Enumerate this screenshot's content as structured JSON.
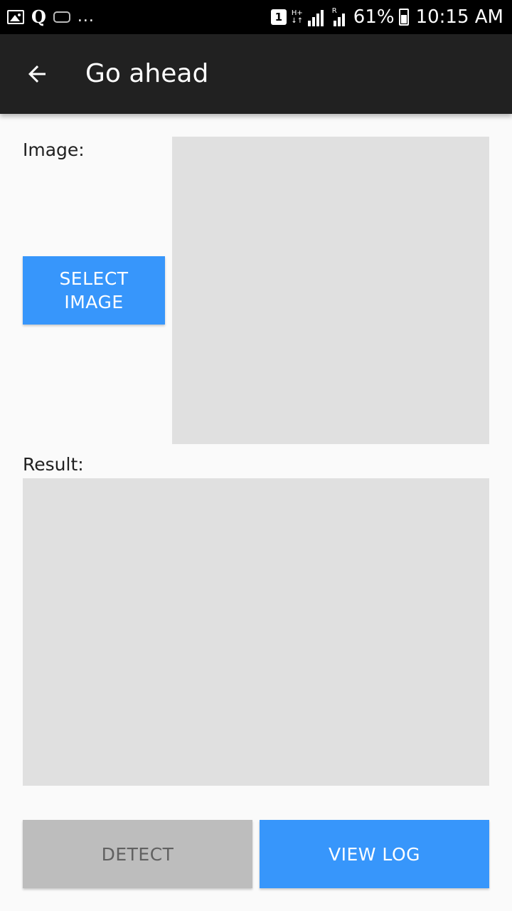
{
  "status_bar": {
    "q_glyph": "Q",
    "more": "...",
    "sim": "1",
    "network_top": "H+",
    "network_bottom": "↓↑",
    "signal_r": "R",
    "battery": "61%",
    "time": "10:15 AM"
  },
  "toolbar": {
    "back_icon": "arrow-left",
    "title": "Go ahead"
  },
  "image_section": {
    "label": "Image:",
    "select_button": "SELECT IMAGE"
  },
  "result_section": {
    "label": "Result:"
  },
  "actions": {
    "detect": "DETECT",
    "view_log": "VIEW LOG"
  },
  "colors": {
    "accent": "#3796fb",
    "toolbar": "#212121",
    "placeholder": "#e0e0e0",
    "disabled": "#bdbdbd"
  }
}
